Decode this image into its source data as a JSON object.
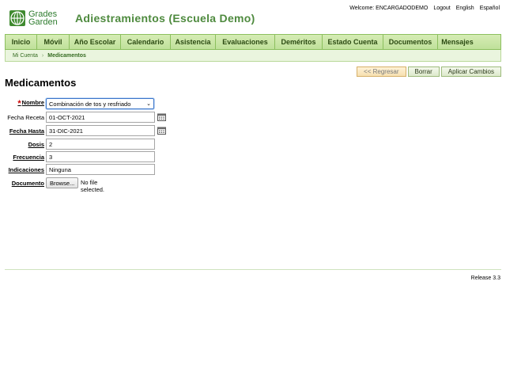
{
  "header": {
    "logo_line1": "Grades",
    "logo_line2": "Garden",
    "school_title": "Adiestramientos (Escuela Demo)",
    "welcome": "Welcome: ENCARGADODEMO",
    "logout": "Logout",
    "lang_en": "English",
    "lang_es": "Español"
  },
  "nav": {
    "items": [
      "Inicio",
      "Móvil",
      "Año Escolar",
      "Calendario",
      "Asistencia",
      "Evaluaciones",
      "Deméritos",
      "Estado Cuenta",
      "Documentos",
      "Mensajes"
    ]
  },
  "breadcrumb": {
    "root": "Mi Cuenta",
    "separator": "›",
    "current": "Medicamentos"
  },
  "actions": {
    "back": "<< Regresar",
    "delete": "Borrar",
    "apply": "Aplicar Cambios"
  },
  "page_title": "Medicamentos",
  "form": {
    "nombre_label": "Nombre",
    "nombre_value": "Combinación de tos y resfriado",
    "fecha_receta_label": "Fecha Receta",
    "fecha_receta_value": "01-OCT-2021",
    "fecha_hasta_label": "Fecha Hasta",
    "fecha_hasta_value": "31-DIC-2021",
    "dosis_label": "Dosis",
    "dosis_value": "2",
    "frecuencia_label": "Frecuencia",
    "frecuencia_value": "3",
    "indicaciones_label": "Indicaciones",
    "indicaciones_value": "Ninguna",
    "documento_label": "Documento",
    "browse_label": "Browse...",
    "file_status": "No file selected."
  },
  "footer": {
    "release": "Release 3.3"
  },
  "colors": {
    "brand_green": "#4e8a3e",
    "nav_bg": "#c8e6a6",
    "required": "#cc0000"
  }
}
